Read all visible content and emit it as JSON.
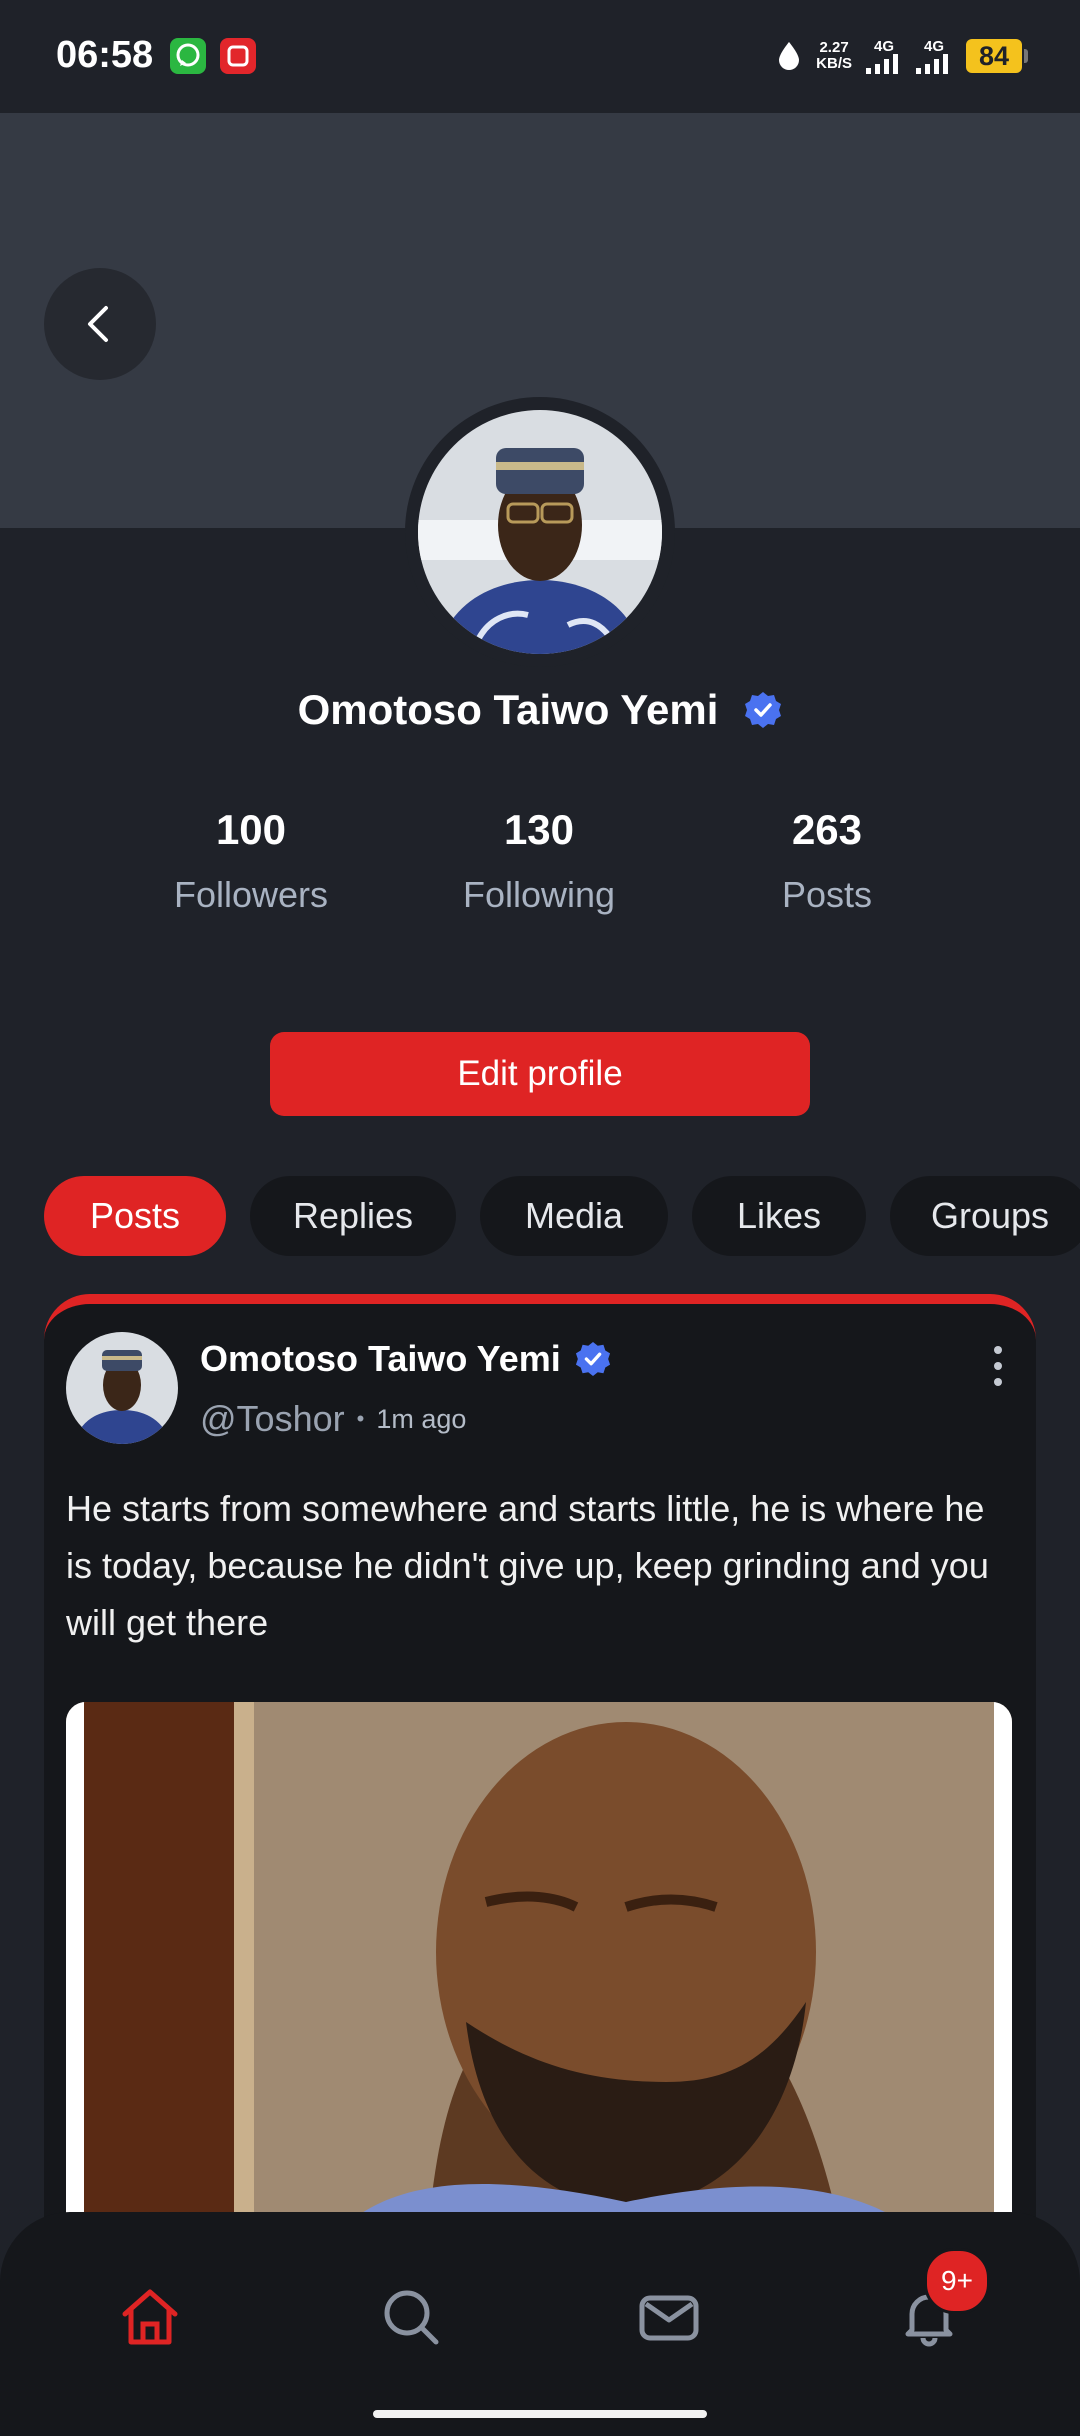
{
  "status_bar": {
    "time": "06:58",
    "speed_value": "2.27",
    "speed_unit": "KB/S",
    "net1": "4G",
    "net2": "4G",
    "battery": "84"
  },
  "profile": {
    "name": "Omotoso Taiwo Yemi",
    "verified": true,
    "stats": [
      {
        "value": "100",
        "label": "Followers"
      },
      {
        "value": "130",
        "label": "Following"
      },
      {
        "value": "263",
        "label": "Posts"
      }
    ],
    "edit_label": "Edit profile"
  },
  "tabs": [
    {
      "label": "Posts",
      "active": true
    },
    {
      "label": "Replies",
      "active": false
    },
    {
      "label": "Media",
      "active": false
    },
    {
      "label": "Likes",
      "active": false
    },
    {
      "label": "Groups",
      "active": false
    }
  ],
  "post": {
    "author": "Omotoso Taiwo Yemi",
    "handle": "@Toshor",
    "separator": "•",
    "time": "1m ago",
    "text": "He starts from somewhere and starts little, he is where he is today, because he didn't give up, keep grinding and you will get there"
  },
  "bottom_nav": {
    "items": [
      "home-icon",
      "search-icon",
      "mail-icon",
      "bell-icon"
    ],
    "notification_badge": "9+"
  },
  "colors": {
    "accent": "#df2424",
    "background": "#1f2229",
    "card": "#15171b",
    "verified": "#4a72f0"
  }
}
